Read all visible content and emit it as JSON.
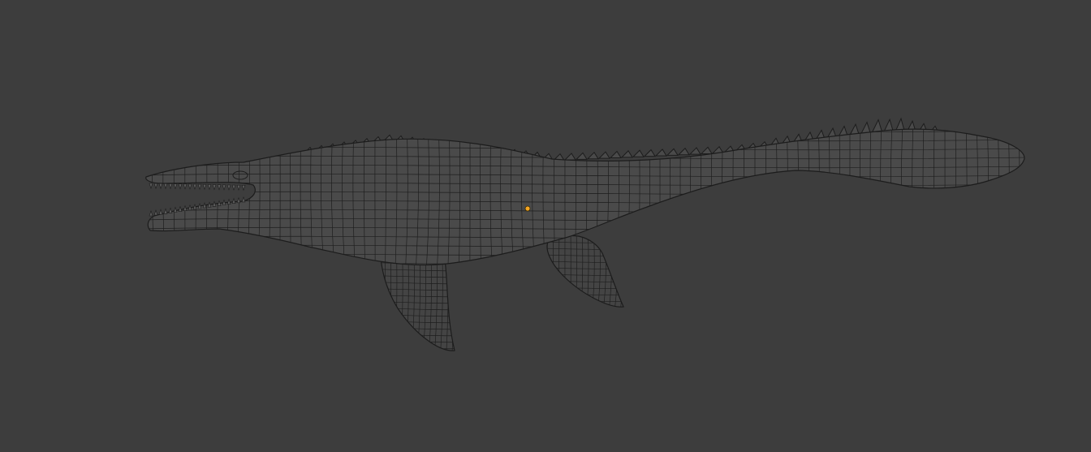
{
  "viewport": {
    "background_color": "#3d3d3d",
    "wire_color": "#1e1e1e",
    "origin_color": "#f5a623",
    "display_mode": "wireframe",
    "object": "mosasaur-mesh"
  }
}
